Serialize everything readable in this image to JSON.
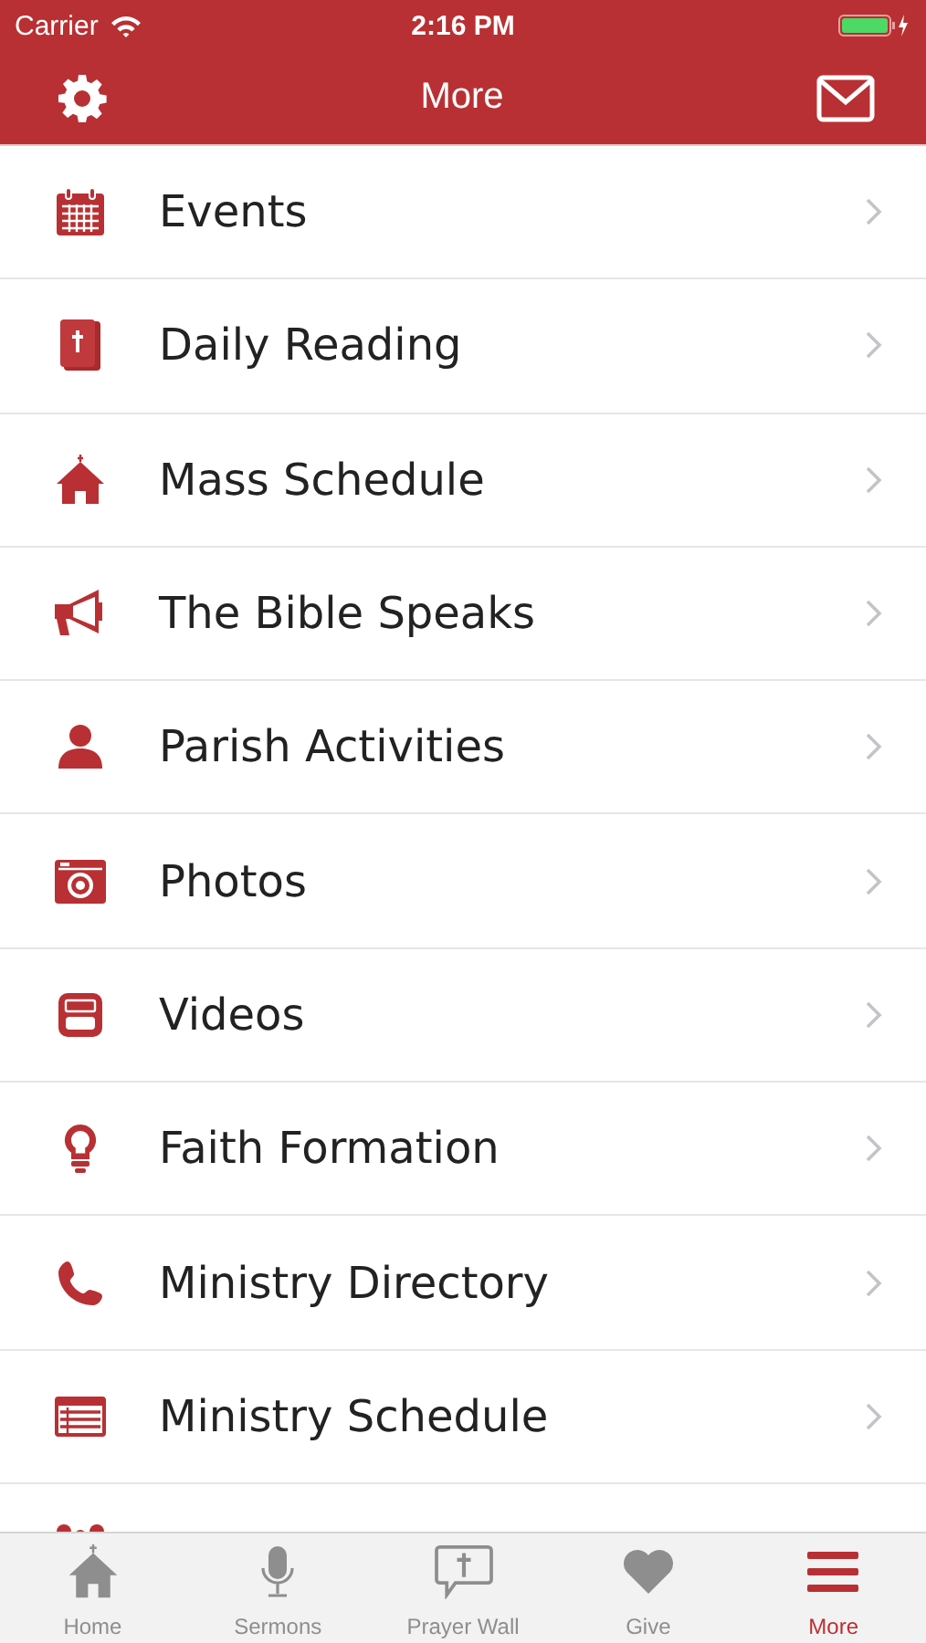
{
  "status_bar": {
    "carrier": "Carrier",
    "time": "2:16 PM"
  },
  "nav_bar": {
    "title": "More"
  },
  "menu": [
    {
      "label": "Events"
    },
    {
      "label": "Daily Reading"
    },
    {
      "label": "Mass Schedule"
    },
    {
      "label": "The Bible Speaks"
    },
    {
      "label": "Parish Activities"
    },
    {
      "label": "Photos"
    },
    {
      "label": "Videos"
    },
    {
      "label": "Faith Formation"
    },
    {
      "label": "Ministry Directory"
    },
    {
      "label": "Ministry Schedule"
    }
  ],
  "tabs": [
    {
      "label": "Home",
      "selected": false
    },
    {
      "label": "Sermons",
      "selected": false
    },
    {
      "label": "Prayer Wall",
      "selected": false
    },
    {
      "label": "Give",
      "selected": false
    },
    {
      "label": "More",
      "selected": true
    }
  ]
}
